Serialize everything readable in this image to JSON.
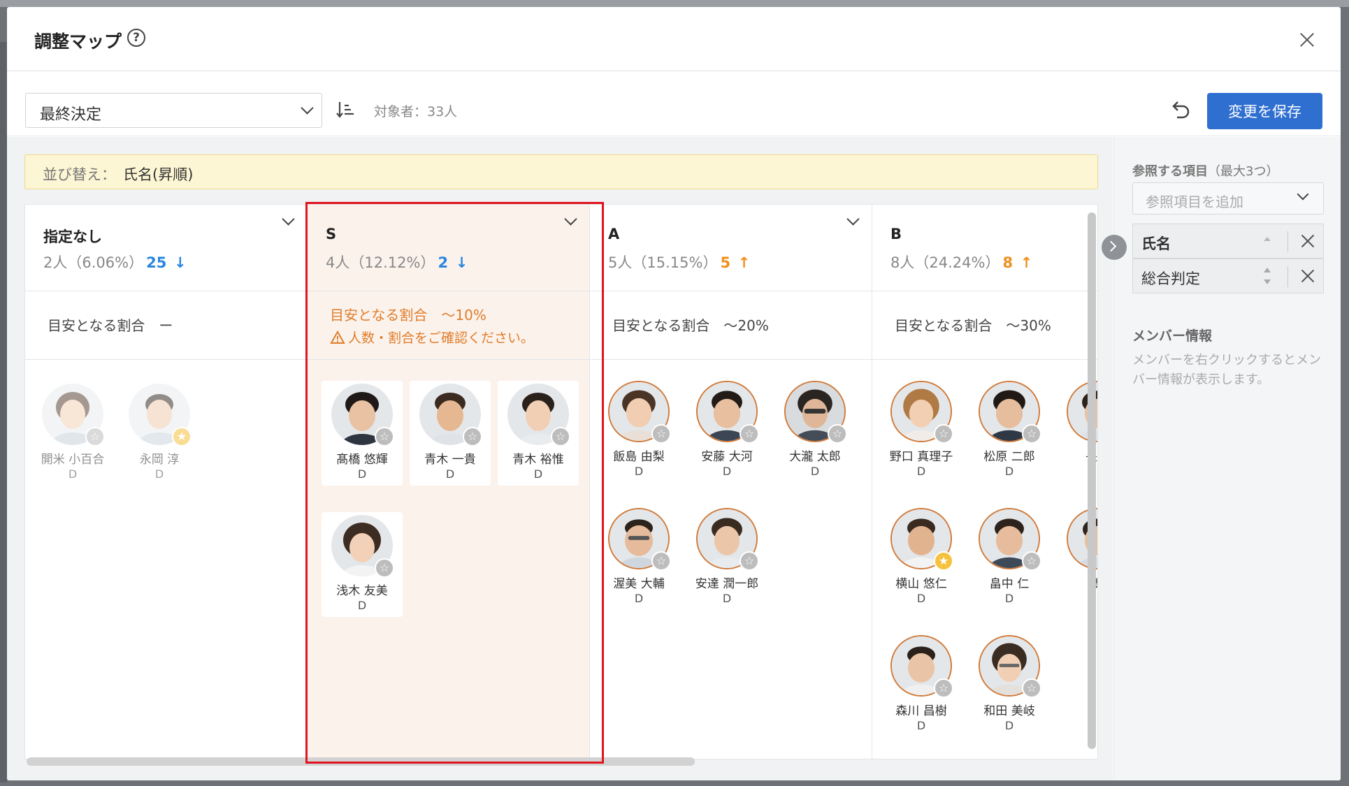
{
  "modal": {
    "title": "調整マップ",
    "help_glyph": "?"
  },
  "toolbar": {
    "select_value": "最終決定",
    "target_count": "対象者：33人",
    "save_label": "変更を保存"
  },
  "sort_banner": {
    "label": "並び替え：",
    "value": "氏名(昇順)"
  },
  "columns": [
    {
      "name": "指定なし",
      "count": "2人",
      "percent": "（6.06%）",
      "diff": "25",
      "arrow": "↓",
      "target": "目安となる割合　ー",
      "members": [
        {
          "name": "開米 小百合",
          "grade": "D",
          "starred": false
        },
        {
          "name": "永岡 淳",
          "grade": "D",
          "starred": true
        }
      ]
    },
    {
      "name": "S",
      "count": "4人",
      "percent": "（12.12%）",
      "diff": "2",
      "arrow": "↓",
      "target": "目安となる割合　～10%",
      "warning": "人数・割合をご確認ください。",
      "members": [
        {
          "name": "髙橋 悠輝",
          "grade": "D",
          "starred": false
        },
        {
          "name": "青木 一貴",
          "grade": "D",
          "starred": false
        },
        {
          "name": "青木 裕惟",
          "grade": "D",
          "starred": false
        },
        {
          "name": "浅木 友美",
          "grade": "D",
          "starred": false
        }
      ]
    },
    {
      "name": "A",
      "count": "5人",
      "percent": "（15.15%）",
      "diff": "5",
      "arrow": "↑",
      "target": "目安となる割合　～20%",
      "members": [
        {
          "name": "飯島 由梨",
          "grade": "D",
          "starred": false
        },
        {
          "name": "安藤 大河",
          "grade": "D",
          "starred": false
        },
        {
          "name": "大瀧 太郎",
          "grade": "D",
          "starred": false
        },
        {
          "name": "渥美 大輔",
          "grade": "D",
          "starred": false
        },
        {
          "name": "安達 潤一郎",
          "grade": "D",
          "starred": false
        }
      ]
    },
    {
      "name": "B",
      "count": "8人",
      "percent": "（24.24%）",
      "diff": "8",
      "arrow": "↑",
      "target": "目安となる割合　～30%",
      "members": [
        {
          "name": "野口 真理子",
          "grade": "D",
          "starred": false
        },
        {
          "name": "松原 二郎",
          "grade": "D",
          "starred": false
        },
        {
          "name": "長谷",
          "grade": "",
          "starred": false
        },
        {
          "name": "横山 悠仁",
          "grade": "D",
          "starred": true
        },
        {
          "name": "畠中 仁",
          "grade": "D",
          "starred": false
        },
        {
          "name": "廣",
          "grade": "",
          "starred": false
        },
        {
          "name": "森川 昌樹",
          "grade": "D",
          "starred": false
        },
        {
          "name": "和田 美岐",
          "grade": "D",
          "starred": false
        }
      ]
    }
  ],
  "panel": {
    "ref_heading": "参照する項目",
    "ref_heading_sub": "（最大3つ）",
    "ref_placeholder": "参照項目を追加",
    "ref_items": [
      "氏名",
      "総合判定"
    ],
    "member_heading": "メンバー情報",
    "member_desc": "メンバーを右クリックするとメンバー情報が表示します。"
  },
  "icons": {
    "star": "☆",
    "star_filled": "★"
  },
  "colors": {
    "primary": "#2f6fd0",
    "warning": "#e07d2a",
    "diff_down": "#2a86e0",
    "diff_up": "#f0901e",
    "highlight_border": "#e0141e"
  }
}
